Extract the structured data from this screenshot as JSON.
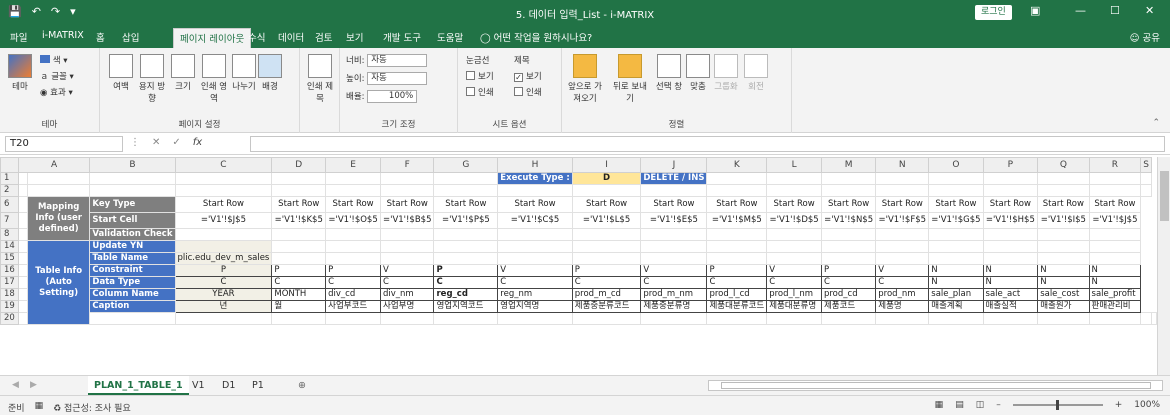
{
  "app": {
    "title": "5. 데이터 입력_List - i-MATRIX",
    "login_label": "로그인",
    "share_label": "공유",
    "brand_color": "#217346"
  },
  "menu": {
    "tabs": [
      "파일",
      "i-MATRIX",
      "홈",
      "삽입",
      "페이지 레이아웃",
      "수식",
      "데이터",
      "검토",
      "보기",
      "개발 도구",
      "도움말"
    ],
    "active_tab": "페이지 레이아웃",
    "tell_me": "어떤 작업을 원하시나요?"
  },
  "ribbon": {
    "theme": {
      "theme": "테마",
      "colors": "색",
      "fonts": "글꼴",
      "effects": "효과",
      "group": "테마"
    },
    "page_setup": {
      "margins": "여백",
      "orientation": "용지 방향",
      "size": "크기",
      "print_area": "인쇄 영역",
      "breaks": "나누기",
      "background": "배경",
      "print_titles": "인쇄 제목",
      "group": "페이지 설정"
    },
    "scale": {
      "width_label": "너비:",
      "width_value": "자동",
      "height_label": "높이:",
      "height_value": "자동",
      "scale_label": "배율:",
      "scale_value": "100%",
      "group": "크기 조정"
    },
    "sheet_options": {
      "gridlines": "눈금선",
      "headings": "제목",
      "view": "보기",
      "print": "인쇄",
      "group": "시트 옵션"
    },
    "arrange": {
      "bring_forward": "앞으로 가져오기",
      "send_backward": "뒤로 보내기",
      "selection_pane": "선택 창",
      "align": "맞춤",
      "group_btn": "그룹화",
      "rotate": "회전",
      "group": "정렬"
    }
  },
  "formula_bar": {
    "name_box": "T20",
    "formula": ""
  },
  "grid": {
    "columns": [
      "A",
      "B",
      "C",
      "D",
      "E",
      "F",
      "G",
      "H",
      "I",
      "J",
      "K",
      "L",
      "M",
      "N",
      "O",
      "P",
      "Q",
      "R",
      "S"
    ],
    "row_numbers": [
      "1",
      "2",
      "6",
      "7",
      "8",
      "14",
      "15",
      "16",
      "17",
      "18",
      "19",
      "20"
    ],
    "execute_label": "Execute Type :",
    "execute_value": "D",
    "execute_mode": "DELETE / INS",
    "mapping_info": "Mapping Info (user defined)",
    "table_info": "Table Info (Auto Setting)",
    "labels": {
      "key_type": "Key Type",
      "start_cell": "Start Cell",
      "validation_check": "Validation Check",
      "update_yn": "Update YN",
      "table_name": "Table Name",
      "constraint": "Constraint",
      "data_type": "Data Type",
      "column_name": "Column Name",
      "caption": "Caption"
    },
    "table_name_value": "plic.edu_dev_m_sales",
    "key_type": [
      "Start Row",
      "Start Row",
      "Start Row",
      "Start Row",
      "Start Row",
      "Start Row",
      "Start Row",
      "Start Row",
      "Start Row",
      "Start Row",
      "Start Row",
      "Start Row",
      "Start Row",
      "Start Row",
      "Start Row",
      "Start Row"
    ],
    "start_cell": [
      "='V1'!$J$5",
      "='V1'!$K$5",
      "='V1'!$O$5",
      "='V1'!$B$5",
      "='V1'!$P$5",
      "='V1'!$C$5",
      "='V1'!$L$5",
      "='V1'!$E$5",
      "='V1'!$M$5",
      "='V1'!$D$5",
      "='V1'!$N$5",
      "='V1'!$F$5",
      "='V1'!$G$5",
      "='V1'!$H$5",
      "='V1'!$I$5",
      "='V1'!$J$5"
    ],
    "constraint": [
      "P",
      "P",
      "P",
      "V",
      "P",
      "V",
      "P",
      "V",
      "P",
      "V",
      "P",
      "V",
      "N",
      "N",
      "N",
      "N"
    ],
    "data_type": [
      "C",
      "C",
      "C",
      "C",
      "C",
      "C",
      "C",
      "C",
      "C",
      "C",
      "C",
      "C",
      "N",
      "N",
      "N",
      "N"
    ],
    "column_name": [
      "YEAR",
      "MONTH",
      "div_cd",
      "div_nm",
      "reg_cd",
      "reg_nm",
      "prod_m_cd",
      "prod_m_nm",
      "prod_l_cd",
      "prod_l_nm",
      "prod_cd",
      "prod_nm",
      "sale_plan",
      "sale_act",
      "sale_cost",
      "sale_profit"
    ],
    "caption": [
      "년",
      "월",
      "사업부코드",
      "사업부명",
      "영업지역코드",
      "영업지역명",
      "제품중분류코드",
      "제품중분류명",
      "제품대분류코드",
      "제품대분류명",
      "제품코드",
      "제품명",
      "매출계획",
      "매출실적",
      "매출원가",
      "판매관리비"
    ]
  },
  "sheets": {
    "tabs": [
      "PLAN_1_TABLE_1",
      "V1",
      "D1",
      "P1"
    ],
    "active": "PLAN_1_TABLE_1"
  },
  "status": {
    "ready": "준비",
    "accessibility": "접근성: 조사 필요",
    "zoom": "100%"
  }
}
